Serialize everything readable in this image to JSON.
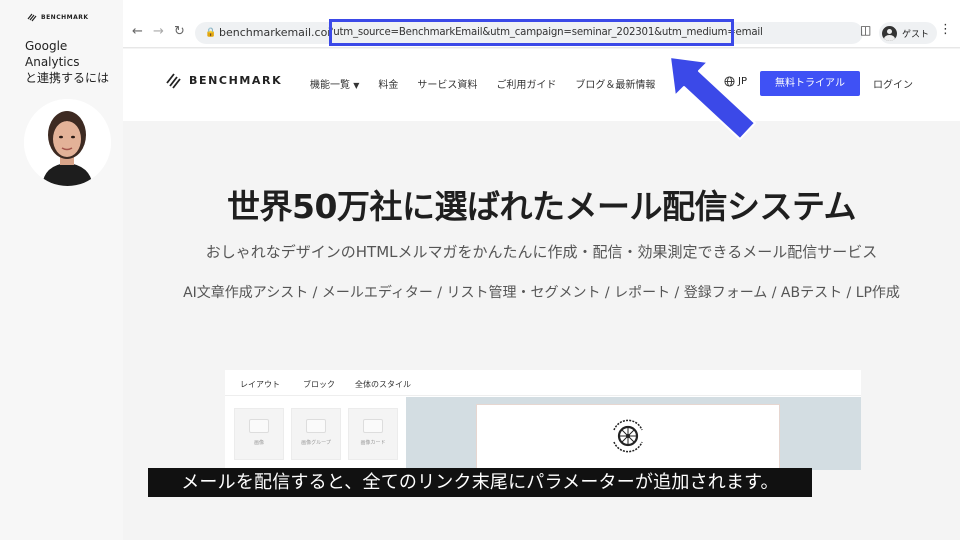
{
  "left_panel": {
    "logo_text": "BENCHMARK",
    "title_line1": "Google Analytics",
    "title_line2": "と連携するには"
  },
  "browser": {
    "back_icon": "arrow-left-icon",
    "forward_icon": "arrow-right-icon",
    "reload_icon": "reload-icon",
    "url_domain": "benchmarkemail.com/jp/",
    "url_params": "?utm_source=BenchmarkEmail&utm_campaign=seminar_202301&utm_medium=email",
    "profile_label": "ゲスト",
    "highlight_color": "#3b49e8"
  },
  "site": {
    "brand": "BENCHMARK",
    "menu": [
      "機能一覧",
      "料金",
      "サービス資料",
      "ご利用ガイド",
      "ブログ＆最新情報"
    ],
    "lang": "JP",
    "cta": "無料トライアル",
    "login": "ログイン",
    "cta_color": "#3f51f5"
  },
  "hero": {
    "title": "世界50万社に選ばれたメール配信システム",
    "subtitle": "おしゃれなデザインのHTMLメルマガをかんたんに作成・配信・効果測定できるメール配信サービス",
    "features": "AI文章作成アシスト / メールエディター / リスト管理・セグメント / レポート / 登録フォーム / ABテスト / LP作成"
  },
  "editor": {
    "tabs": [
      "レイアウト",
      "ブロック",
      "全体のスタイル"
    ],
    "blocks": [
      "画像",
      "画像グループ",
      "画像カード"
    ]
  },
  "caption": "メールを配信すると、全てのリンク末尾にパラメーターが追加されます。"
}
